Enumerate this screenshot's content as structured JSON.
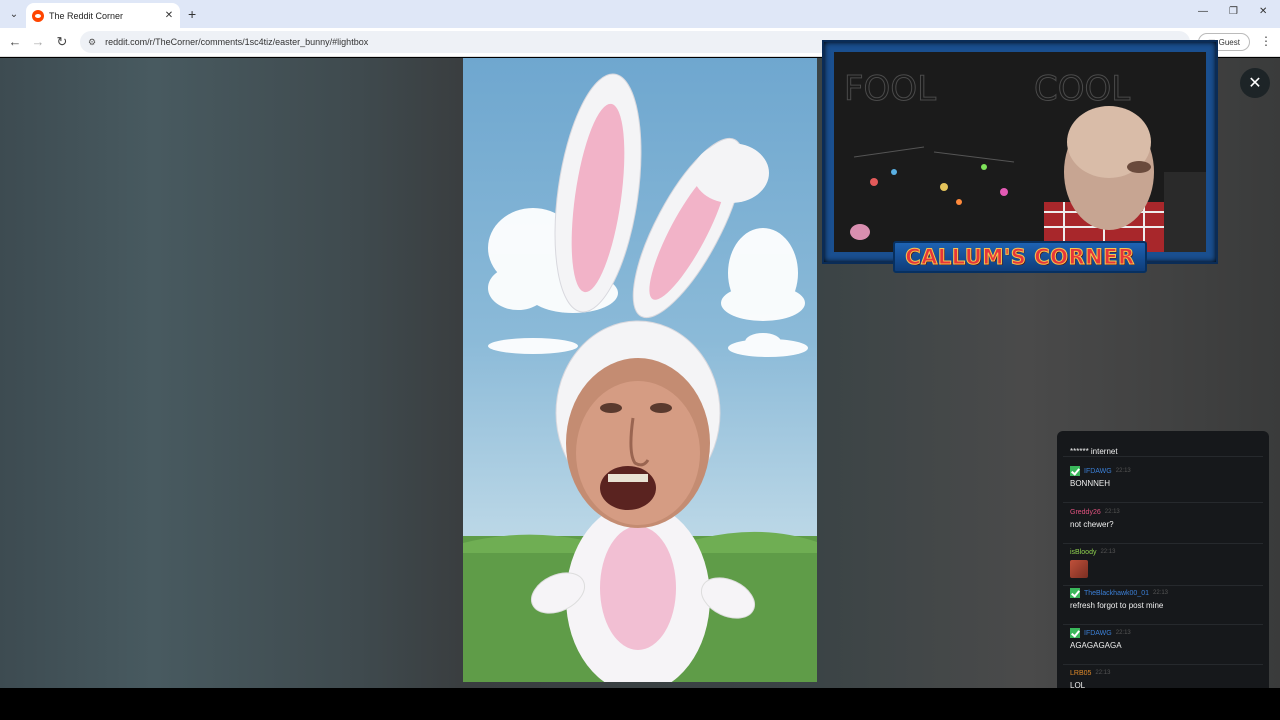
{
  "browser": {
    "tab_title": "The Reddit Corner",
    "url": "reddit.com/r/TheCorner/comments/1sc4tiz/easter_bunny/#lightbox",
    "profile_label": "Guest"
  },
  "icons": {
    "tab_list": "chevron-down-icon",
    "tab_close": "close-icon",
    "new_tab": "plus-icon",
    "minimize": "minimize-icon",
    "restore": "restore-icon",
    "window_close": "close-icon",
    "back": "arrow-left-icon",
    "forward": "arrow-right-icon",
    "reload": "reload-icon",
    "site_info": "tune-icon",
    "menu": "kebab-icon",
    "lightbox_close": "close-icon"
  },
  "glyphs": {
    "tab_list": "⌄",
    "tab_close": "✕",
    "new_tab": "+",
    "minimize": "—",
    "restore": "❐",
    "window_close": "✕",
    "back": "←",
    "forward": "→",
    "reload": "↻",
    "site_info": "⚙",
    "menu": "⋮",
    "lightbox_close": "✕",
    "profile": "◪"
  },
  "stream": {
    "banner": "CALLUM'S CORNER",
    "chalkboard_words": [
      "FOOL",
      "COOL"
    ]
  },
  "chat": {
    "first_message_text": "****** internet",
    "messages": [
      {
        "user": "IFDAWG",
        "time": "22:13",
        "text": "BONNNEH",
        "user_color": "#3b7fd6",
        "badge": true
      },
      {
        "user": "Greddy26",
        "time": "22:13",
        "text": "not chewer?",
        "user_color": "#e0527f",
        "badge": false
      },
      {
        "user": "isBloody",
        "time": "22:13",
        "text": "",
        "user_color": "#8fd14f",
        "badge": false,
        "emote": true
      },
      {
        "user": "TheBlackhawk00_01",
        "time": "22:13",
        "text": "refresh forgot to post mine",
        "user_color": "#3b7fd6",
        "badge": true
      },
      {
        "user": "IFDAWG",
        "time": "22:13",
        "text": "AGAGAGAGA",
        "user_color": "#3b7fd6",
        "badge": true
      },
      {
        "user": "LRB05",
        "time": "22:13",
        "text": "LOL",
        "user_color": "#e08a2a",
        "badge": false
      }
    ]
  },
  "colors": {
    "tabbar": "#dfe7f7",
    "banner_text": "#e6353a",
    "banner_outline": "#f6c64e",
    "badge_green": "#3ab75b"
  }
}
